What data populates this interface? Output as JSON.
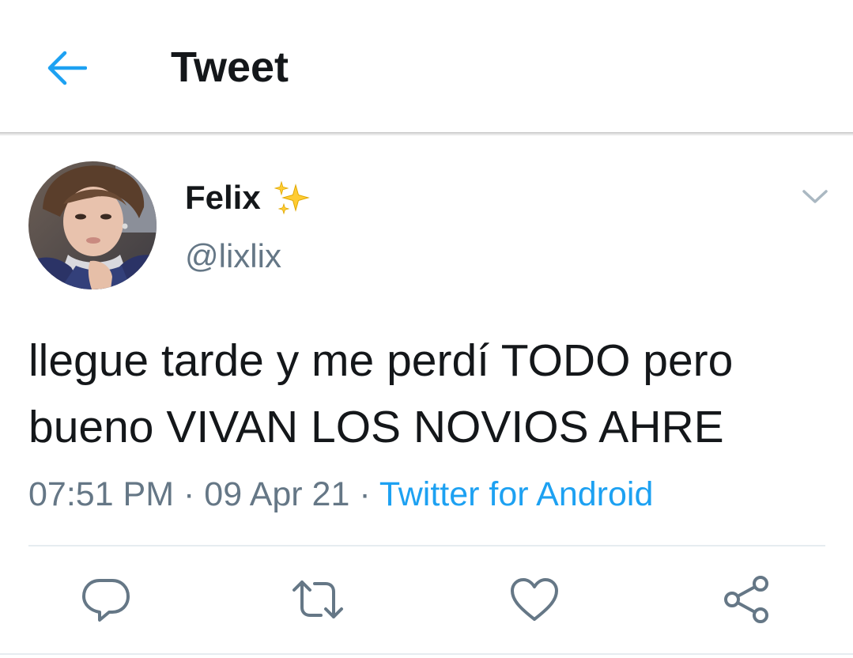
{
  "header": {
    "title": "Tweet",
    "back_icon": "arrow-left-icon",
    "accent_color": "#1da1f2"
  },
  "tweet": {
    "author": {
      "display_name": "Felix",
      "emoji": "sparkles-icon",
      "handle": "@lixlix"
    },
    "text_line1": "llegue tarde y me perdí TODO pero",
    "text_line2": "bueno VIVAN LOS NOVIOS AHRE",
    "time": "07:51 PM",
    "separator": "·",
    "date": "09 Apr 21",
    "source": "Twitter for Android",
    "menu_icon": "chevron-down-icon"
  },
  "actions": {
    "icons": [
      "reply-icon",
      "retweet-icon",
      "like-icon",
      "share-icon"
    ],
    "icon_color": "#657786"
  },
  "colors": {
    "text_primary": "#14171a",
    "text_secondary": "#657786",
    "divider": "#e6ecf0"
  }
}
